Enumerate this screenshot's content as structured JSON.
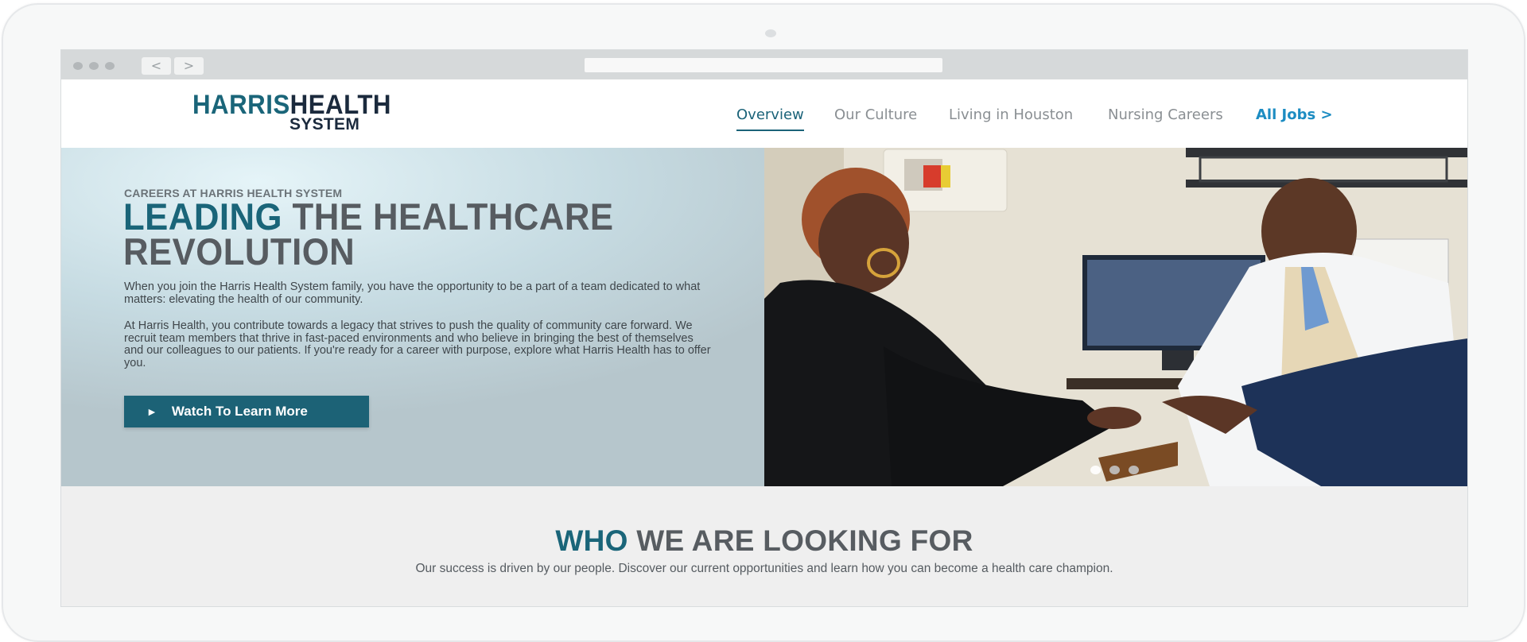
{
  "browser": {
    "back_glyph": "<",
    "forward_glyph": ">"
  },
  "logo": {
    "word1": "HARRIS",
    "word2": "HEALTH",
    "word3": "SYSTEM"
  },
  "nav": {
    "items": [
      {
        "label": "Overview"
      },
      {
        "label": "Our Culture"
      },
      {
        "label": "Living in Houston"
      },
      {
        "label": "Nursing Careers"
      },
      {
        "label": "All Jobs >"
      }
    ],
    "active_index": 0
  },
  "hero": {
    "eyebrow": "CAREERS AT HARRIS HEALTH SYSTEM",
    "headline_accent": "LEADING",
    "headline_rest": " THE HEALTHCARE REVOLUTION",
    "paragraph1": "When you join the Harris Health System family, you have the opportunity to be a part of a team dedicated to what matters: elevating the health of our community.",
    "paragraph2": "At Harris Health, you contribute towards a legacy that strives to push the quality of community care forward. We recruit team members that thrive in fast-paced environments and who believe in bringing the best of themselves and our colleagues to our patients. If you're ready for a career with purpose, explore what Harris Health has to offer you.",
    "cta_icon": "►",
    "cta_label": "Watch To Learn More",
    "carousel_total": 3,
    "carousel_active": 0
  },
  "section": {
    "title_accent": "WHO",
    "title_rest": " WE ARE LOOKING FOR",
    "subtitle": "Our success is driven by our people. Discover our current opportunities and learn how you can become a health care champion."
  },
  "colors": {
    "brand_teal": "#1a6579",
    "brand_navy": "#1b2a3d",
    "link_blue": "#1c8cc2",
    "button_bg": "#1c6276"
  }
}
